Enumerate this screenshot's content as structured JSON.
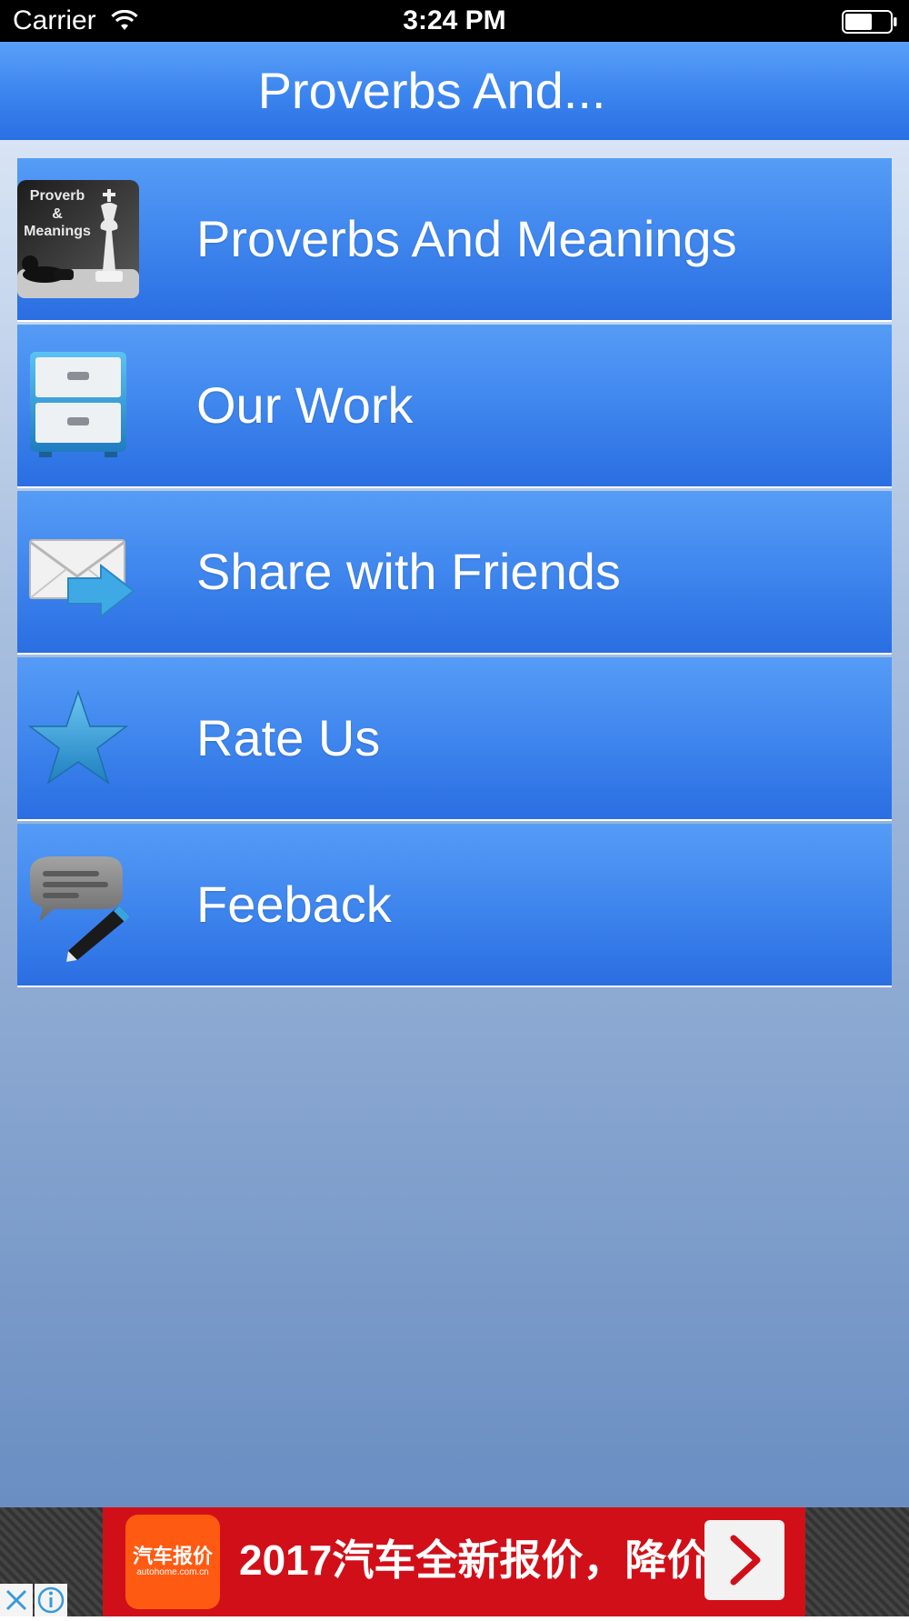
{
  "status_bar": {
    "carrier": "Carrier",
    "time": "3:24 PM",
    "icons": [
      "wifi-icon",
      "battery-icon"
    ]
  },
  "nav_bar": {
    "title": "Proverbs And..."
  },
  "menu": {
    "items": [
      {
        "label": "Proverbs And Meanings",
        "icon": "proverb-meanings-chess-icon",
        "icon_text_1": "Proverb",
        "icon_text_2": "&",
        "icon_text_3": "Meanings"
      },
      {
        "label": "Our Work",
        "icon": "file-cabinet-icon"
      },
      {
        "label": "Share with Friends",
        "icon": "mail-share-icon"
      },
      {
        "label": "Rate Us",
        "icon": "star-icon"
      },
      {
        "label": "Feeback",
        "icon": "chat-pencil-icon"
      }
    ]
  },
  "ad": {
    "logo_text": "汽车报价",
    "logo_subtext": "autohome.com.cn",
    "text": "2017汽车全新报价，降价",
    "icons": [
      "ad-arrow-icon",
      "ad-close-icon",
      "ad-info-icon"
    ]
  },
  "colors": {
    "nav_blue": "#3d86ef",
    "menu_blue": "#3f86ee",
    "ad_red": "#d10f18",
    "ad_logo_orange": "#ff5a12"
  }
}
